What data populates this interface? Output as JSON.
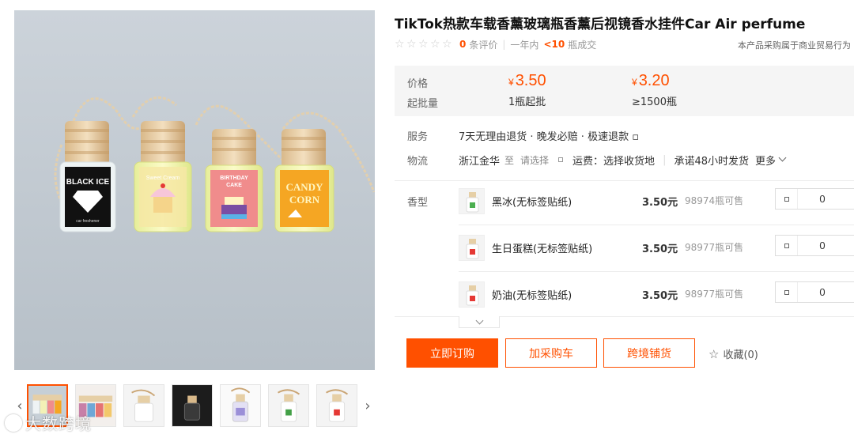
{
  "product": {
    "title": "TikTok热款车载香薰玻璃瓶香薰后视镜香水挂件Car Air perfume"
  },
  "rating": {
    "stars": 0,
    "review_count": "0",
    "review_label": "条评价",
    "period_label": "一年内",
    "sold_count": "<10",
    "sold_label": "瓶成交",
    "business_note": "本产品采购属于商业贸易行为"
  },
  "pricing": {
    "price_label": "价格",
    "moq_label": "起批量",
    "currency": "¥",
    "tiers": [
      {
        "price": "3.50",
        "moq": "1瓶起批"
      },
      {
        "price": "3.20",
        "moq": "≥1500瓶"
      }
    ]
  },
  "service": {
    "label": "服务",
    "text": "7天无理由退货 · 晚发必赔 · 极速退款 ▫"
  },
  "logistics": {
    "label": "物流",
    "origin": "浙江金华",
    "to": "至",
    "choose": "请选择",
    "fee": "运费：选择收货地",
    "promise": "承诺48小时发货",
    "more": "更多"
  },
  "variants": {
    "label": "香型",
    "items": [
      {
        "name": "黑冰(无标签贴纸)",
        "price": "3.50元",
        "stock": "98974瓶可售",
        "qty": "0",
        "swatch": "#4caf50"
      },
      {
        "name": "生日蛋糕(无标签贴纸)",
        "price": "3.50元",
        "stock": "98977瓶可售",
        "qty": "0",
        "swatch": "#e53935"
      },
      {
        "name": "奶油(无标签贴纸)",
        "price": "3.50元",
        "stock": "98977瓶可售",
        "qty": "0",
        "swatch": "#e53935"
      }
    ]
  },
  "actions": {
    "buy_now": "立即订购",
    "add_cart": "加采购车",
    "cross_border": "跨境铺货",
    "favorite": "收藏(0)"
  },
  "gallery": {
    "bottles": [
      {
        "label_line1": "BLACK ICE",
        "label_line2": "car freshener",
        "label_color": "#111111"
      },
      {
        "label_line1": "Sweet Cream",
        "label_line2": "",
        "label_color": "#f6e8a5"
      },
      {
        "label_line1": "BIRTHDAY",
        "label_line2": "CAKE",
        "label_color": "#f08c8c"
      },
      {
        "label_line1": "CANDY",
        "label_line2": "CORN",
        "label_color": "#f5a623"
      }
    ],
    "watermark": "大数跨境"
  },
  "colors": {
    "accent": "#ff5000",
    "price_bg": "#f5f5f5"
  }
}
